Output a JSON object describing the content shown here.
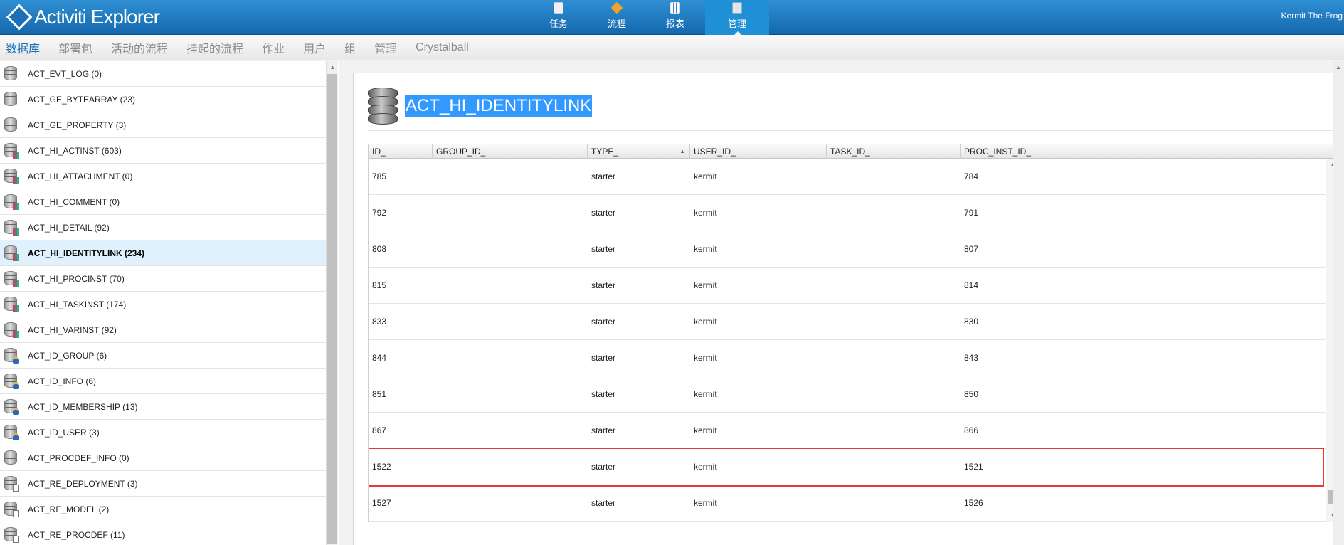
{
  "app": {
    "title": "Activiti Explorer",
    "user": "Kermit The Frog"
  },
  "nav": [
    {
      "label": "任务",
      "icon": "tasks-icon",
      "active": false
    },
    {
      "label": "流程",
      "icon": "process-icon",
      "active": false
    },
    {
      "label": "报表",
      "icon": "reports-icon",
      "active": false
    },
    {
      "label": "管理",
      "icon": "manage-icon",
      "active": true
    }
  ],
  "submenu": [
    {
      "label": "数据库",
      "active": true
    },
    {
      "label": "部署包",
      "active": false
    },
    {
      "label": "活动的流程",
      "active": false
    },
    {
      "label": "挂起的流程",
      "active": false
    },
    {
      "label": "作业",
      "active": false
    },
    {
      "label": "用户",
      "active": false
    },
    {
      "label": "组",
      "active": false
    },
    {
      "label": "管理",
      "active": false
    },
    {
      "label": "Crystalball",
      "active": false
    }
  ],
  "tables": [
    {
      "label": "ACT_EVT_LOG (0)",
      "badge": "none"
    },
    {
      "label": "ACT_GE_BYTEARRAY (23)",
      "badge": "none"
    },
    {
      "label": "ACT_GE_PROPERTY (3)",
      "badge": "none"
    },
    {
      "label": "ACT_HI_ACTINST (603)",
      "badge": "hist"
    },
    {
      "label": "ACT_HI_ATTACHMENT (0)",
      "badge": "hist"
    },
    {
      "label": "ACT_HI_COMMENT (0)",
      "badge": "hist"
    },
    {
      "label": "ACT_HI_DETAIL (92)",
      "badge": "hist"
    },
    {
      "label": "ACT_HI_IDENTITYLINK (234)",
      "badge": "hist",
      "selected": true
    },
    {
      "label": "ACT_HI_PROCINST (70)",
      "badge": "hist"
    },
    {
      "label": "ACT_HI_TASKINST (174)",
      "badge": "hist"
    },
    {
      "label": "ACT_HI_VARINST (92)",
      "badge": "hist"
    },
    {
      "label": "ACT_ID_GROUP (6)",
      "badge": "user"
    },
    {
      "label": "ACT_ID_INFO (6)",
      "badge": "user"
    },
    {
      "label": "ACT_ID_MEMBERSHIP (13)",
      "badge": "user"
    },
    {
      "label": "ACT_ID_USER (3)",
      "badge": "user"
    },
    {
      "label": "ACT_PROCDEF_INFO (0)",
      "badge": "none"
    },
    {
      "label": "ACT_RE_DEPLOYMENT (3)",
      "badge": "doc"
    },
    {
      "label": "ACT_RE_MODEL (2)",
      "badge": "doc"
    },
    {
      "label": "ACT_RE_PROCDEF (11)",
      "badge": "doc"
    }
  ],
  "detail": {
    "title": "ACT_HI_IDENTITYLINK",
    "columns": [
      "ID_",
      "GROUP_ID_",
      "TYPE_",
      "USER_ID_",
      "TASK_ID_",
      "PROC_INST_ID_"
    ],
    "sorted_column": "TYPE_",
    "rows": [
      {
        "id": "785",
        "group_id": "",
        "type": "starter",
        "user_id": "kermit",
        "task_id": "",
        "proc_inst_id": "784"
      },
      {
        "id": "792",
        "group_id": "",
        "type": "starter",
        "user_id": "kermit",
        "task_id": "",
        "proc_inst_id": "791"
      },
      {
        "id": "808",
        "group_id": "",
        "type": "starter",
        "user_id": "kermit",
        "task_id": "",
        "proc_inst_id": "807"
      },
      {
        "id": "815",
        "group_id": "",
        "type": "starter",
        "user_id": "kermit",
        "task_id": "",
        "proc_inst_id": "814"
      },
      {
        "id": "833",
        "group_id": "",
        "type": "starter",
        "user_id": "kermit",
        "task_id": "",
        "proc_inst_id": "830"
      },
      {
        "id": "844",
        "group_id": "",
        "type": "starter",
        "user_id": "kermit",
        "task_id": "",
        "proc_inst_id": "843"
      },
      {
        "id": "851",
        "group_id": "",
        "type": "starter",
        "user_id": "kermit",
        "task_id": "",
        "proc_inst_id": "850"
      },
      {
        "id": "867",
        "group_id": "",
        "type": "starter",
        "user_id": "kermit",
        "task_id": "",
        "proc_inst_id": "866"
      },
      {
        "id": "1522",
        "group_id": "",
        "type": "starter",
        "user_id": "kermit",
        "task_id": "",
        "proc_inst_id": "1521",
        "highlighted": true
      },
      {
        "id": "1527",
        "group_id": "",
        "type": "starter",
        "user_id": "kermit",
        "task_id": "",
        "proc_inst_id": "1526"
      }
    ]
  },
  "colors": {
    "header": "#1568ad",
    "accent": "#1a6fb6",
    "selection": "#dff1fc",
    "highlight": "#e53935"
  }
}
